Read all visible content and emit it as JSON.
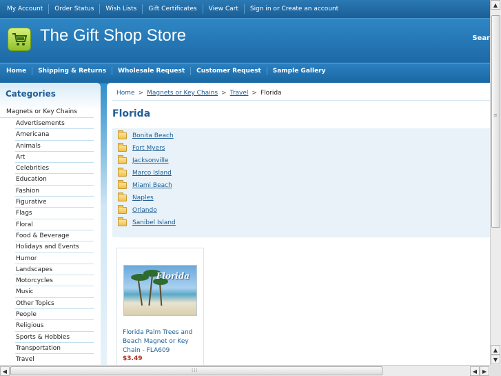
{
  "topbar": {
    "links": [
      "My Account",
      "Order Status",
      "Wish Lists",
      "Gift Certificates",
      "View Cart",
      "Sign in or Create an account"
    ]
  },
  "header": {
    "store_name": "The Gift Shop Store",
    "search_label": "Sear"
  },
  "nav": {
    "links": [
      "Home",
      "Shipping & Returns",
      "Wholesale Request",
      "Customer Request",
      "Sample Gallery"
    ]
  },
  "sidebar": {
    "heading": "Categories",
    "top_category": "Magnets or Key Chains",
    "items": [
      "Advertisements",
      "Americana",
      "Animals",
      "Art",
      "Celebrities",
      "Education",
      "Fashion",
      "Figurative",
      "Flags",
      "Floral",
      "Food & Beverage",
      "Holidays and Events",
      "Humor",
      "Landscapes",
      "Motorcycles",
      "Music",
      "Other Topics",
      "People",
      "Religious",
      "Sports & Hobbies",
      "Transportation",
      "Travel"
    ]
  },
  "breadcrumb": {
    "home": "Home",
    "category": "Magnets or Key Chains",
    "subcategory": "Travel",
    "current": "Florida"
  },
  "page": {
    "title": "Florida"
  },
  "subcategories": [
    "Bonita Beach",
    "Fort Myers",
    "Jacksonville",
    "Marco Island",
    "Miami Beach",
    "Naples",
    "Orlando",
    "Sanibel Island"
  ],
  "product": {
    "image_caption": "Florida",
    "name": "Florida Palm Trees and Beach Magnet or Key Chain - FLA609",
    "price": "$3.49"
  },
  "colors": {
    "brand_blue": "#1f6fae",
    "link": "#1a5e97",
    "price": "#b02a1a",
    "heading": "#1f5f97"
  },
  "icons": {
    "logo": "shopping-cart-icon",
    "subcategory": "folder-icon"
  }
}
